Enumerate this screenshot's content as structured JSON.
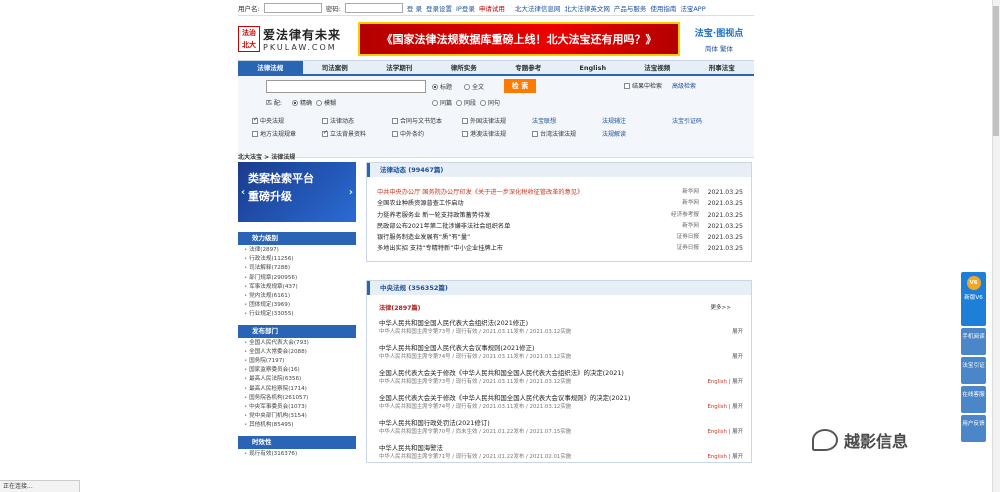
{
  "login": {
    "user_label": "用户名:",
    "pass_label": "密码:",
    "links": [
      "登 录",
      "登录设置",
      "IP登录",
      "申请试用",
      "北大法律信息网",
      "北大法律英文网",
      "产品与服务",
      "使用指南",
      "法宝APP"
    ]
  },
  "banner": {
    "seal": "法治\n北大",
    "logo_cn": "爱法律有未来",
    "logo_en": "PKULAW.COM",
    "ad_text": "《国家法律法规数据库重磅上线！北大法宝还有用吗？》",
    "brand": "法宝·图视点",
    "lang": "简体 繁体"
  },
  "nav": {
    "tabs": [
      "法律法规",
      "司法案例",
      "法学期刊",
      "律所实务",
      "专题参考",
      "English",
      "法宝视频",
      "刑事法宝"
    ],
    "active": 0
  },
  "search": {
    "options1": [
      "标题",
      "全文"
    ],
    "button": "检 索",
    "right1": "结果中检索",
    "right2": "高级检索",
    "match_label": "匹 配:",
    "match_opts": [
      "精确",
      "模糊"
    ],
    "scope_opts": [
      "同篇",
      "同段",
      "同句"
    ],
    "databases": [
      {
        "label": "中央法规",
        "checked": true
      },
      {
        "label": "法律动态",
        "checked": false
      },
      {
        "label": "合同与文书范本",
        "checked": false
      },
      {
        "label": "外国法律法规",
        "checked": false
      },
      {
        "label": "法宝联想",
        "checked": null
      },
      {
        "label": "法规辅注",
        "checked": null
      },
      {
        "label": "法宝引证码",
        "checked": null
      },
      {
        "label": "地方法规规章",
        "checked": false
      },
      {
        "label": "立法背景资料",
        "checked": true
      },
      {
        "label": "中外条约",
        "checked": false
      },
      {
        "label": "港澳法律法规",
        "checked": false
      },
      {
        "label": "台湾法律法规",
        "checked": false
      },
      {
        "label": "法规解读",
        "checked": null
      },
      {
        "label": "",
        "checked": null
      }
    ]
  },
  "breadcrumb": "北大法宝 > 法律法规",
  "promo": {
    "line1": "类案检索平台",
    "line2": "重磅升级"
  },
  "panels": [
    {
      "title": "效力级别",
      "items": [
        "法律(2897)",
        "行政法规(11256)",
        "司法解释(7288)",
        "部门规章(290956)",
        "军事法规规章(437)",
        "党内法规(6161)",
        "团体规定(3969)",
        "行业规定(33055)"
      ]
    },
    {
      "title": "发布部门",
      "items": [
        "全国人民代表大会(793)",
        "全国人大常委会(2088)",
        "国务院(7197)",
        "国家监察委员会(16)",
        "最高人民法院(6356)",
        "最高人民检察院(1714)",
        "国务院各机构(261057)",
        "中央军事委员会(1073)",
        "党中央部门机构(3154)",
        "其他机构(85495)"
      ]
    },
    {
      "title": "时效性",
      "items": [
        "现行有效(316376)"
      ]
    }
  ],
  "dynamics": {
    "title": "法律动态 (99467篇)",
    "rows": [
      {
        "t": "中共中央办公厅 国务院办公厅印发《关于进一步深化税收征管改革的意见》",
        "s": "新华网",
        "d": "2021.03.25",
        "red": true
      },
      {
        "t": "全国农业种质资源普查工作启动",
        "s": "新华网",
        "d": "2021.03.25",
        "red": false
      },
      {
        "t": "力挺养老服务业 新一轮支持政策蓄势待发",
        "s": "经济参考报",
        "d": "2021.03.25",
        "red": false
      },
      {
        "t": "民政部公布2021年第二批涉嫌非法社会组织名单",
        "s": "新华网",
        "d": "2021.03.25",
        "red": false
      },
      {
        "t": "银行服务制造业发展有“质”有“量”",
        "s": "证券日报",
        "d": "2021.03.25",
        "red": false
      },
      {
        "t": "多地出实招 支持“专精特新”中小企业挂牌上市",
        "s": "证券日报",
        "d": "2021.03.25",
        "red": false
      }
    ]
  },
  "central": {
    "title": "中央法规 (356352篇)",
    "sub": "法律(2897篇)",
    "more": "更多>>",
    "laws": [
      {
        "t": "中华人民共和国全国人民代表大会组织法(2021修正)",
        "m": "中华人民共和国主席令第73号 / 现行有效 / 2021.03.11发布 / 2021.03.12实施",
        "en": "",
        "r": "展开"
      },
      {
        "t": "中华人民共和国全国人民代表大会议事规则(2021修正)",
        "m": "中华人民共和国主席令第74号 / 现行有效 / 2021.03.11发布 / 2021.03.12实施",
        "en": "",
        "r": "展开"
      },
      {
        "t": "全国人民代表大会关于修改《中华人民共和国全国人民代表大会组织法》的决定(2021)",
        "m": "中华人民共和国主席令第73号 / 现行有效 / 2021.03.11发布 / 2021.03.12实施",
        "en": "English",
        "r": "展开"
      },
      {
        "t": "全国人民代表大会关于修改《中华人民共和国全国人民代表大会议事规则》的决定(2021)",
        "m": "中华人民共和国主席令第74号 / 现行有效 / 2021.03.11发布 / 2021.03.12实施",
        "en": "English",
        "r": "展开"
      },
      {
        "t": "中华人民共和国行政处罚法(2021修订)",
        "m": "中华人民共和国主席令第70号 / 尚未生效 / 2021.01.22发布 / 2021.07.15实施",
        "en": "English",
        "r": "展开"
      },
      {
        "t": "中华人民共和国海警法",
        "m": "中华人民共和国主席令第71号 / 现行有效 / 2021.01.22发布 / 2021.02.01实施",
        "en": "English",
        "r": "展开"
      }
    ]
  },
  "float": {
    "v6": "V6",
    "items": [
      "新版V6",
      "手机阅读",
      "法宝引证",
      "在线客服",
      "用户反馈"
    ]
  },
  "status": "正在连接...",
  "watermark": "越影信息"
}
